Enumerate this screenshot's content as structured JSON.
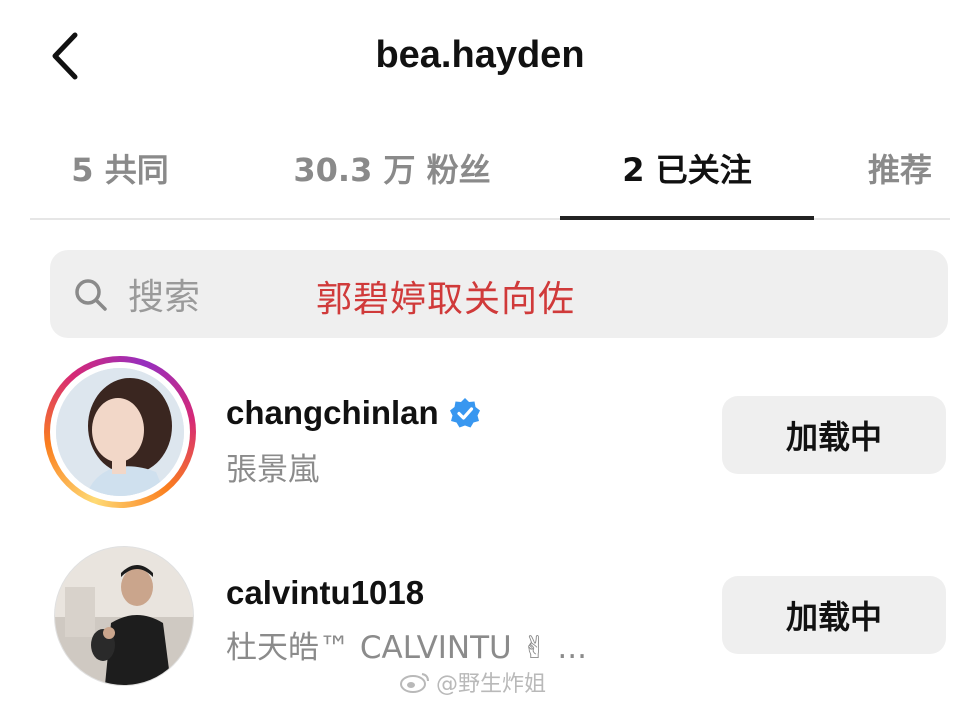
{
  "header": {
    "title": "bea.hayden",
    "back_icon": "chevron-left-icon"
  },
  "tabs": [
    {
      "label": "5 共同",
      "active": false
    },
    {
      "label": "30.3 万 粉丝",
      "active": false
    },
    {
      "label": "2 已关注",
      "active": true
    },
    {
      "label": "推荐",
      "active": false
    }
  ],
  "search": {
    "placeholder": "搜索",
    "icon": "search-icon"
  },
  "annotation": {
    "text": "郭碧婷取关向佐",
    "color": "#d03a3a"
  },
  "users": [
    {
      "username": "changchinlan",
      "verified": true,
      "fullname": "張景嵐",
      "has_story_ring": true,
      "button_label": "加载中"
    },
    {
      "username": "calvintu1018",
      "verified": false,
      "fullname": "杜天皓™ CALVINTU ✌ ...",
      "has_story_ring": false,
      "button_label": "加载中"
    }
  ],
  "watermark": {
    "text": "@野生炸姐"
  },
  "colors": {
    "verified_badge": "#3897f0",
    "annotation": "#d03a3a",
    "button_bg": "#efefef"
  }
}
